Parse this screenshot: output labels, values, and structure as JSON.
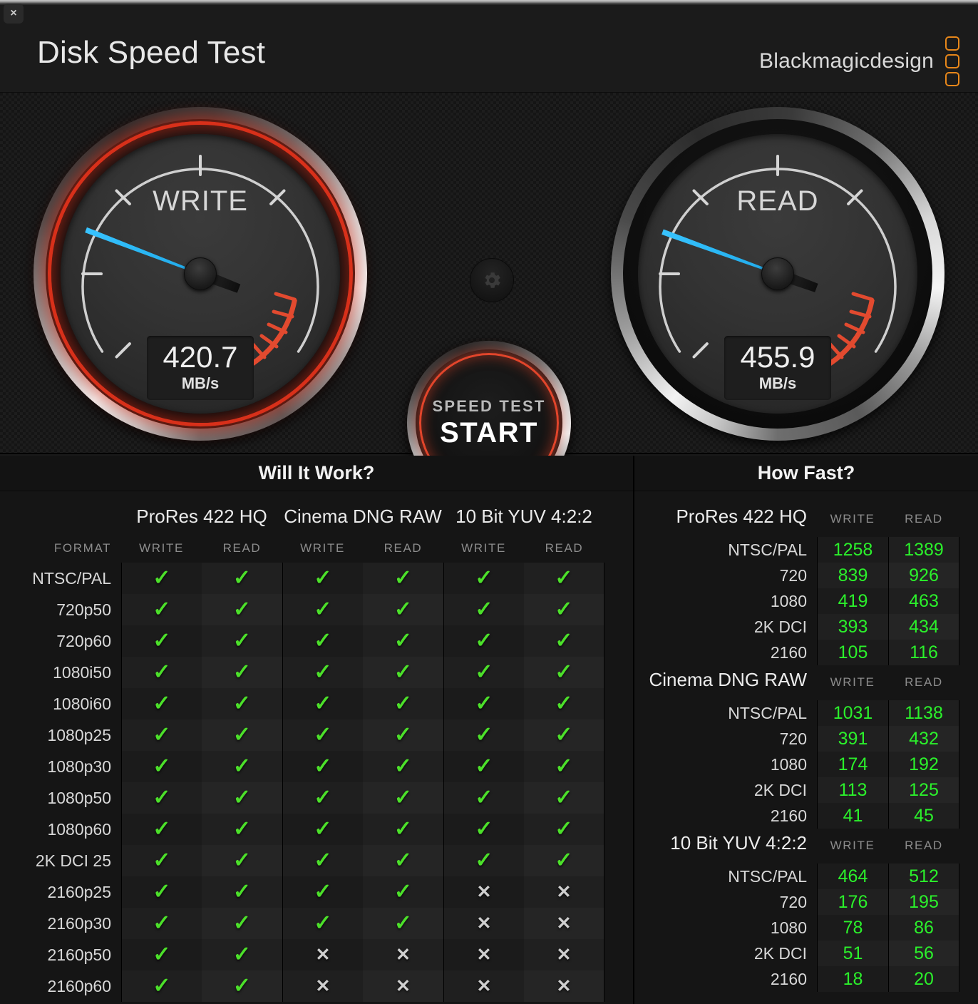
{
  "window": {
    "close_label": "×"
  },
  "header": {
    "title": "Disk Speed Test",
    "brand": "Blackmagicdesign",
    "brand_color": "#E8871A"
  },
  "gauges": {
    "write": {
      "label": "WRITE",
      "value": "420.7",
      "unit": "MB/s",
      "angle_deg": 201
    },
    "read": {
      "label": "READ",
      "value": "455.9",
      "unit": "MB/s",
      "angle_deg": 200
    }
  },
  "start_button": {
    "line1": "SPEED TEST",
    "line2": "START"
  },
  "settings_button": {
    "icon": "gear-icon"
  },
  "will_it_work": {
    "title": "Will It Work?",
    "format_header": "FORMAT",
    "groups": [
      "ProRes 422 HQ",
      "Cinema DNG RAW",
      "10 Bit YUV 4:2:2"
    ],
    "subheaders": [
      "WRITE",
      "READ",
      "WRITE",
      "READ",
      "WRITE",
      "READ"
    ],
    "ok_glyph": "✓",
    "no_glyph": "✕",
    "rows": [
      {
        "label": "NTSC/PAL",
        "cells": [
          true,
          true,
          true,
          true,
          true,
          true
        ]
      },
      {
        "label": "720p50",
        "cells": [
          true,
          true,
          true,
          true,
          true,
          true
        ]
      },
      {
        "label": "720p60",
        "cells": [
          true,
          true,
          true,
          true,
          true,
          true
        ]
      },
      {
        "label": "1080i50",
        "cells": [
          true,
          true,
          true,
          true,
          true,
          true
        ]
      },
      {
        "label": "1080i60",
        "cells": [
          true,
          true,
          true,
          true,
          true,
          true
        ]
      },
      {
        "label": "1080p25",
        "cells": [
          true,
          true,
          true,
          true,
          true,
          true
        ]
      },
      {
        "label": "1080p30",
        "cells": [
          true,
          true,
          true,
          true,
          true,
          true
        ]
      },
      {
        "label": "1080p50",
        "cells": [
          true,
          true,
          true,
          true,
          true,
          true
        ]
      },
      {
        "label": "1080p60",
        "cells": [
          true,
          true,
          true,
          true,
          true,
          true
        ]
      },
      {
        "label": "2K DCI 25",
        "cells": [
          true,
          true,
          true,
          true,
          true,
          true
        ]
      },
      {
        "label": "2160p25",
        "cells": [
          true,
          true,
          true,
          true,
          false,
          false
        ]
      },
      {
        "label": "2160p30",
        "cells": [
          true,
          true,
          true,
          true,
          false,
          false
        ]
      },
      {
        "label": "2160p50",
        "cells": [
          true,
          true,
          false,
          false,
          false,
          false
        ]
      },
      {
        "label": "2160p60",
        "cells": [
          true,
          true,
          false,
          false,
          false,
          false
        ]
      }
    ]
  },
  "how_fast": {
    "title": "How Fast?",
    "col_write": "WRITE",
    "col_read": "READ",
    "sections": [
      {
        "name": "ProRes 422 HQ",
        "rows": [
          {
            "label": "NTSC/PAL",
            "write": "1258",
            "read": "1389"
          },
          {
            "label": "720",
            "write": "839",
            "read": "926"
          },
          {
            "label": "1080",
            "write": "419",
            "read": "463"
          },
          {
            "label": "2K DCI",
            "write": "393",
            "read": "434"
          },
          {
            "label": "2160",
            "write": "105",
            "read": "116"
          }
        ]
      },
      {
        "name": "Cinema DNG RAW",
        "rows": [
          {
            "label": "NTSC/PAL",
            "write": "1031",
            "read": "1138"
          },
          {
            "label": "720",
            "write": "391",
            "read": "432"
          },
          {
            "label": "1080",
            "write": "174",
            "read": "192"
          },
          {
            "label": "2K DCI",
            "write": "113",
            "read": "125"
          },
          {
            "label": "2160",
            "write": "41",
            "read": "45"
          }
        ]
      },
      {
        "name": "10 Bit YUV 4:2:2",
        "rows": [
          {
            "label": "NTSC/PAL",
            "write": "464",
            "read": "512"
          },
          {
            "label": "720",
            "write": "176",
            "read": "195"
          },
          {
            "label": "1080",
            "write": "78",
            "read": "86"
          },
          {
            "label": "2K DCI",
            "write": "51",
            "read": "56"
          },
          {
            "label": "2160",
            "write": "18",
            "read": "20"
          }
        ]
      }
    ]
  }
}
